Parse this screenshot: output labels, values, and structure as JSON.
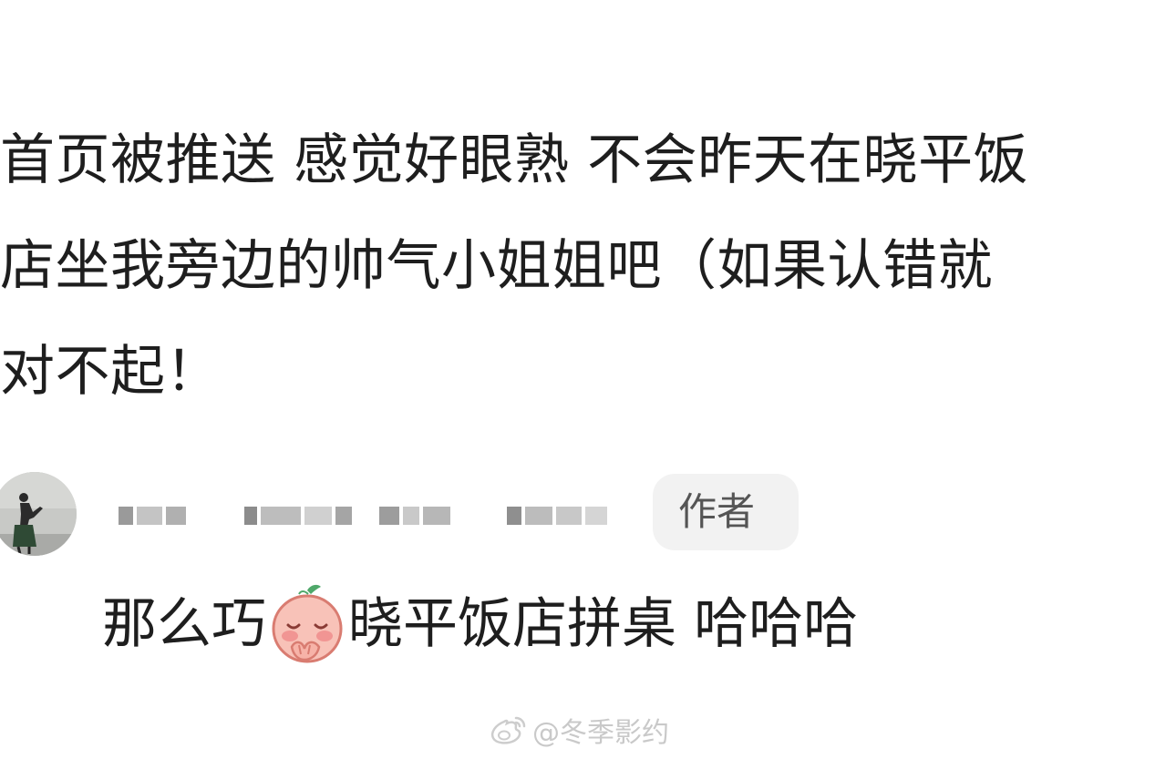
{
  "comment": {
    "lines": [
      "首页被推送 感觉好眼熟 不会昨天在晓平饭",
      "店坐我旁边的帅气小姐姐吧（如果认错就",
      "对不起！"
    ]
  },
  "reply": {
    "username": "",
    "badge": "作者",
    "text_before_emoji": "那么巧",
    "emoji": "shy-peach-emoji",
    "text_after_emoji": "晓平饭店拼桌 哈哈哈"
  },
  "watermark": {
    "icon": "weibo-icon",
    "text": "@冬季影约"
  },
  "colors": {
    "text": "#1e1e1e",
    "badge_bg": "#f2f2f2",
    "badge_text": "#555555",
    "watermark": "#c9c9c9"
  }
}
